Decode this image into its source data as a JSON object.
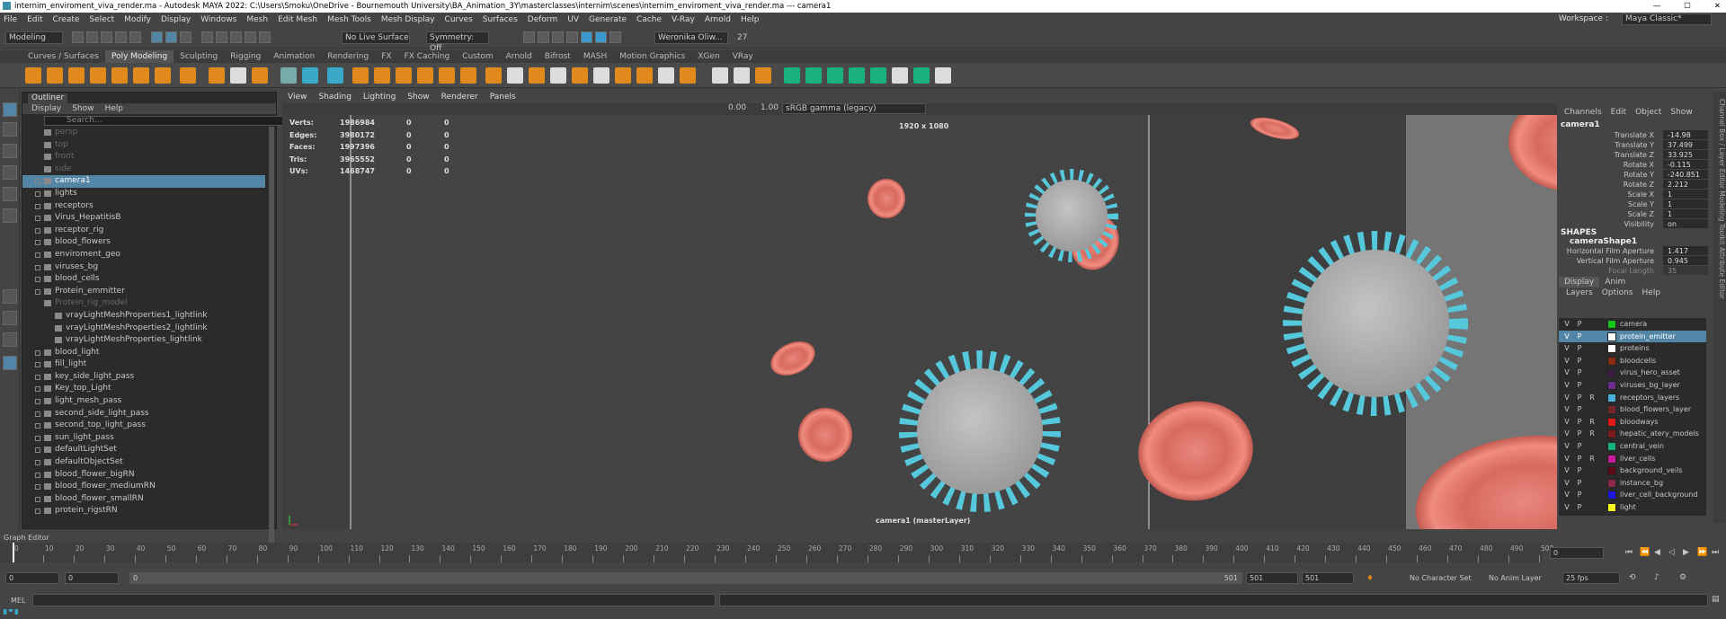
{
  "window": {
    "title": "internim_enviroment_viva_render.ma - Autodesk MAYA 2022: C:\\Users\\Smoku\\OneDrive - Bournemouth University\\BA_Animation_3Y\\masterclasses\\internim\\scenes\\internim_enviroment_viva_render.ma  ---   camera1",
    "minimize": "—",
    "maximize": "☐",
    "close": "✕"
  },
  "menu": [
    "File",
    "Edit",
    "Create",
    "Select",
    "Modify",
    "Display",
    "Windows",
    "Mesh",
    "Edit Mesh",
    "Mesh Tools",
    "Mesh Display",
    "Curves",
    "Surfaces",
    "Deform",
    "UV",
    "Generate",
    "Cache",
    "V-Ray",
    "Arnold",
    "Help"
  ],
  "workspace": {
    "label": "Workspace :",
    "value": "Maya Classic*"
  },
  "status": {
    "mode": "Modeling",
    "live": "No Live Surface",
    "symmetry": "Symmetry: Off",
    "user": "Weronika Oliw...",
    "notif": "27"
  },
  "shelf_tabs": [
    "Curves / Surfaces",
    "Poly Modeling",
    "Sculpting",
    "Rigging",
    "Animation",
    "Rendering",
    "FX",
    "FX Caching",
    "Custom",
    "Arnold",
    "Bifrost",
    "MASH",
    "Motion Graphics",
    "XGen",
    "VRay"
  ],
  "outliner": {
    "tab": "Outliner",
    "menu": [
      "Display",
      "Show",
      "Help"
    ],
    "search": "Search...",
    "items": [
      {
        "label": "persp",
        "dim": true
      },
      {
        "label": "top",
        "dim": true
      },
      {
        "label": "front",
        "dim": true
      },
      {
        "label": "side",
        "dim": true
      },
      {
        "label": "camera1",
        "sel": true
      },
      {
        "label": "lights"
      },
      {
        "label": "receptors"
      },
      {
        "label": "Virus_HepatitisB"
      },
      {
        "label": "receptor_rig"
      },
      {
        "label": "blood_flowers"
      },
      {
        "label": "enviroment_geo"
      },
      {
        "label": "viruses_bg"
      },
      {
        "label": "blood_cells"
      },
      {
        "label": "Protein_emmitter"
      },
      {
        "label": "Protein_rig_model",
        "dim": true
      },
      {
        "label": "vrayLightMeshProperties1_lightlink",
        "indent": true
      },
      {
        "label": "vrayLightMeshProperties2_lightlink",
        "indent": true
      },
      {
        "label": "vrayLightMeshProperties_lightlink",
        "indent": true
      },
      {
        "label": "blood_light"
      },
      {
        "label": "fill_light"
      },
      {
        "label": "key_side_light_pass"
      },
      {
        "label": "Key_top_Light"
      },
      {
        "label": "light_mesh_pass"
      },
      {
        "label": "second_side_light_pass"
      },
      {
        "label": "second_top_light_pass"
      },
      {
        "label": "sun_light_pass"
      },
      {
        "label": "defaultLightSet"
      },
      {
        "label": "defaultObjectSet"
      },
      {
        "label": "blood_flower_bigRN"
      },
      {
        "label": "blood_flower_mediumRN"
      },
      {
        "label": "blood_flower_smallRN"
      },
      {
        "label": "protein_rigstRN"
      }
    ]
  },
  "viewport": {
    "menu": [
      "View",
      "Shading",
      "Lighting",
      "Show",
      "Renderer",
      "Panels"
    ],
    "exposure": "0.00",
    "gamma": "1.00",
    "colorspace": "sRGB gamma (legacy)",
    "hud": [
      {
        "label": "Verts:",
        "a": "1986984",
        "b": "0",
        "c": "0"
      },
      {
        "label": "Edges:",
        "a": "3980172",
        "b": "0",
        "c": "0"
      },
      {
        "label": "Faces:",
        "a": "1997396",
        "b": "0",
        "c": "0"
      },
      {
        "label": "Tris:",
        "a": "3965552",
        "b": "0",
        "c": "0"
      },
      {
        "label": "UVs:",
        "a": "1468747",
        "b": "0",
        "c": "0"
      }
    ],
    "resolution": "1920 x 1080",
    "camera_label": "camera1 (masterLayer)"
  },
  "channelbox": {
    "menu": [
      "Channels",
      "Edit",
      "Object",
      "Show"
    ],
    "object": "camera1",
    "attrs": [
      {
        "name": "Translate X",
        "value": "-14.98"
      },
      {
        "name": "Translate Y",
        "value": "37.499"
      },
      {
        "name": "Translate Z",
        "value": "33.925"
      },
      {
        "name": "Rotate X",
        "value": "-0.115"
      },
      {
        "name": "Rotate Y",
        "value": "-240.851"
      },
      {
        "name": "Rotate Z",
        "value": "2.212"
      },
      {
        "name": "Scale X",
        "value": "1"
      },
      {
        "name": "Scale Y",
        "value": "1"
      },
      {
        "name": "Scale Z",
        "value": "1"
      },
      {
        "name": "Visibility",
        "value": "on"
      }
    ],
    "shapes_header": "SHAPES",
    "shape": "cameraShape1",
    "shape_attrs": [
      {
        "name": "Horizontal Film Aperture",
        "value": "1.417"
      },
      {
        "name": "Vertical Film Aperture",
        "value": "0.945"
      },
      {
        "name": "Focal Length",
        "value": "35"
      }
    ]
  },
  "side_tabs": "Channel Box / Layer Editor    Modeling Toolkit    Attribute Editor",
  "layers": {
    "tabs": [
      "Display",
      "Anim"
    ],
    "menu": [
      "Layers",
      "Options",
      "Help"
    ],
    "items": [
      {
        "v": "V",
        "p": "P",
        "r": "",
        "name": "camera",
        "color": "#19c419"
      },
      {
        "v": "V",
        "p": "P",
        "r": "",
        "name": "protein_emitter",
        "color": "#ffffff",
        "sel": true
      },
      {
        "v": "V",
        "p": "P",
        "r": "",
        "name": "proteins",
        "color": "#ffffff"
      },
      {
        "v": "V",
        "p": "P",
        "r": "",
        "name": "bloodcells",
        "color": "#8a2a10"
      },
      {
        "v": "V",
        "p": "P",
        "r": "",
        "name": "virus_hero_asset",
        "color": "#3a1f44"
      },
      {
        "v": "V",
        "p": "P",
        "r": "",
        "name": "viruses_bg_layer",
        "color": "#6a2d8a"
      },
      {
        "v": "V",
        "p": "P",
        "r": "R",
        "name": "receptors_layers",
        "color": "#4ab0d8"
      },
      {
        "v": "V",
        "p": "P",
        "r": "",
        "name": "blood_flowers_layer",
        "color": "#7a2430"
      },
      {
        "v": "V",
        "p": "P",
        "r": "R",
        "name": "bloodways",
        "color": "#e01818"
      },
      {
        "v": "V",
        "p": "P",
        "r": "R",
        "name": "hepatic_atery_models",
        "color": "#7a1a1a"
      },
      {
        "v": "V",
        "p": "P",
        "r": "",
        "name": "central_vein",
        "color": "#18b080"
      },
      {
        "v": "V",
        "p": "P",
        "r": "R",
        "name": "liver_cells",
        "color": "#d01898"
      },
      {
        "v": "V",
        "p": "P",
        "r": "",
        "name": "background_veils",
        "color": "#5a0c14"
      },
      {
        "v": "V",
        "p": "P",
        "r": "",
        "name": "instance_bg",
        "color": "#8a2a4a"
      },
      {
        "v": "V",
        "p": "P",
        "r": "",
        "name": "liver_cell_background",
        "color": "#1818e0"
      },
      {
        "v": "V",
        "p": "P",
        "r": "",
        "name": "light",
        "color": "#ffff18"
      }
    ]
  },
  "graph_editor": "Graph Editor",
  "timeline": {
    "start": 0,
    "end": 500,
    "labels": [
      "0",
      "10",
      "20",
      "30",
      "40",
      "50",
      "60",
      "70",
      "80",
      "90",
      "100",
      "110",
      "120",
      "130",
      "140",
      "150",
      "160",
      "170",
      "180",
      "190",
      "200",
      "210",
      "220",
      "230",
      "240",
      "250",
      "260",
      "270",
      "280",
      "290",
      "300",
      "310",
      "320",
      "330",
      "340",
      "350",
      "360",
      "370",
      "380",
      "390",
      "400",
      "410",
      "420",
      "430",
      "440",
      "450",
      "460",
      "470",
      "480",
      "490",
      "500"
    ],
    "current": "0"
  },
  "range": {
    "start": "0",
    "startInner": "0",
    "rangeStart": "0",
    "rangeEnd": "501",
    "end": "501",
    "end2": "501",
    "charset": "No Character Set",
    "animlayer": "No Anim Layer",
    "fps": "25 fps"
  },
  "cmd": {
    "lang": "MEL"
  }
}
